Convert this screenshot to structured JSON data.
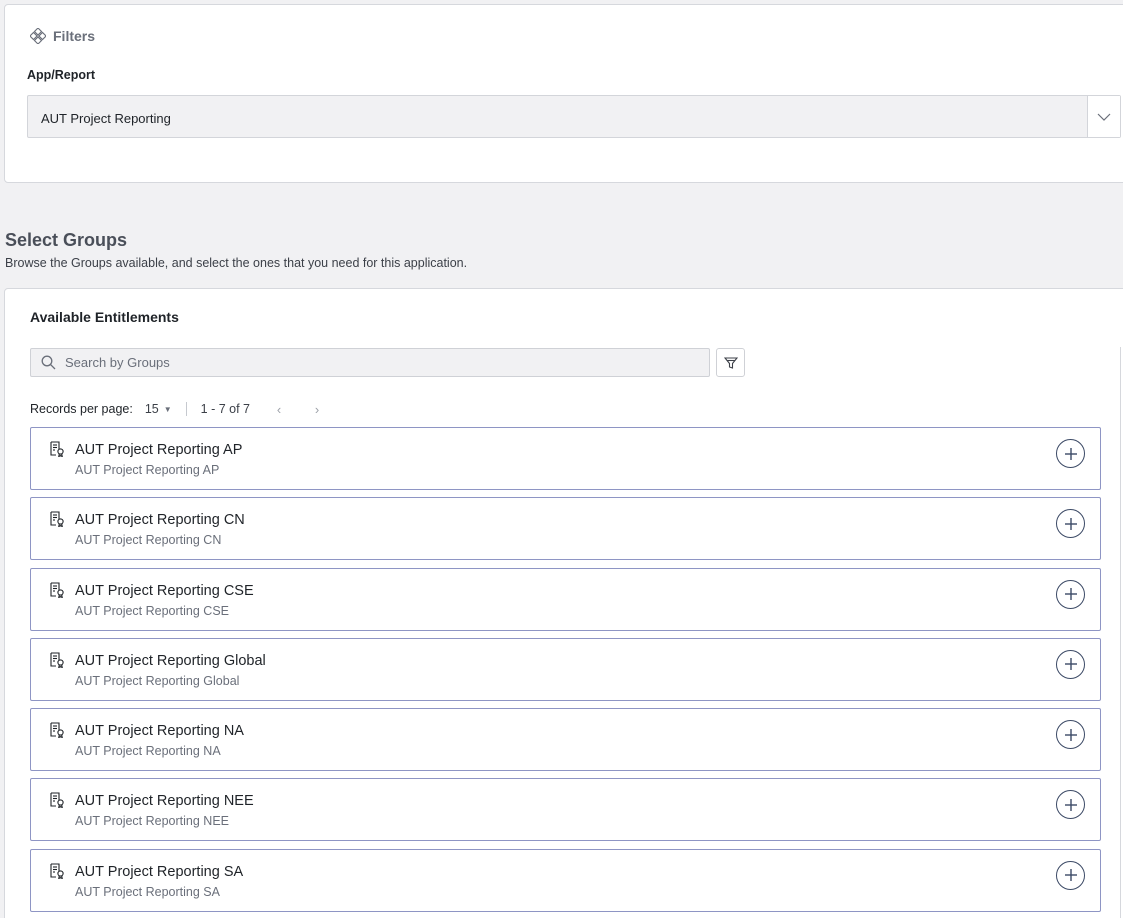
{
  "filters": {
    "title": "Filters",
    "icon": "filter-nodes-icon",
    "app_report_label": "App/Report",
    "app_report_value": "AUT Project Reporting"
  },
  "select_groups": {
    "title": "Select Groups",
    "subtitle": "Browse the Groups available, and select the ones that you need for this application."
  },
  "entitlements": {
    "title": "Available Entitlements",
    "search_placeholder": "Search by Groups",
    "records_label": "Records per page:",
    "per_page": "15",
    "range": "1 - 7 of 7",
    "items": [
      {
        "name": "AUT Project Reporting AP",
        "desc": "AUT Project Reporting AP"
      },
      {
        "name": "AUT Project Reporting CN",
        "desc": "AUT Project Reporting CN"
      },
      {
        "name": "AUT Project Reporting CSE",
        "desc": "AUT Project Reporting CSE"
      },
      {
        "name": "AUT Project Reporting Global",
        "desc": "AUT Project Reporting Global"
      },
      {
        "name": "AUT Project Reporting NA",
        "desc": "AUT Project Reporting NA"
      },
      {
        "name": "AUT Project Reporting NEE",
        "desc": "AUT Project Reporting NEE"
      },
      {
        "name": "AUT Project Reporting SA",
        "desc": "AUT Project Reporting SA"
      }
    ]
  },
  "colors": {
    "background": "#f1f1f3",
    "row_border": "#8e95c4",
    "add_button": "#3c4a66"
  }
}
